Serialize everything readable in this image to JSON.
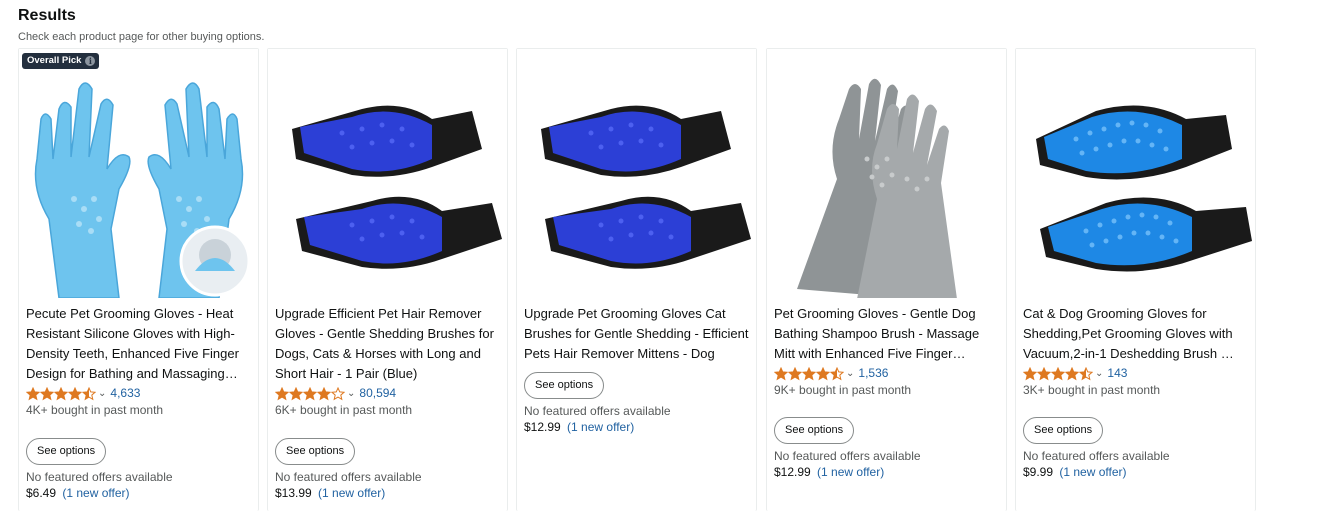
{
  "header": {
    "title": "Results",
    "subtitle": "Check each product page for other buying options."
  },
  "colors": {
    "star_fill": "#de7921",
    "link": "#2162a1",
    "badge_bg": "#232f3e"
  },
  "products": [
    {
      "badge": "Overall Pick",
      "title": "Pecute Pet Grooming Gloves - Heat Resistant Silicone Gloves with High-Density Teeth, Enhanced Five Finger Design for Bathing and Massaging…",
      "rating": 4.5,
      "rating_count": "4,633",
      "bought": "4K+ bought in past month",
      "button": "See options",
      "no_offers": "No featured offers available",
      "price": "$6.49",
      "offer": "(1 new offer)",
      "image_icon": "blue-silicone-gloves"
    },
    {
      "title": "Upgrade Efficient Pet Hair Remover Gloves - Gentle Shedding Brushes for Dogs, Cats & Horses with Long and Short Hair - 1 Pair (Blue)",
      "rating": 4.0,
      "rating_count": "80,594",
      "bought": "6K+ bought in past month",
      "button": "See options",
      "no_offers": "No featured offers available",
      "price": "$13.99",
      "offer": "(1 new offer)",
      "image_icon": "blue-rubber-grooming-gloves"
    },
    {
      "title": "Upgrade Pet Grooming Gloves Cat Brushes for Gentle Shedding - Efficient Pets Hair Remover Mittens - Dog Washing Gloves for Long and…",
      "button": "See options",
      "no_offers": "No featured offers available",
      "price": "$12.99",
      "offer": "(1 new offer)",
      "image_icon": "blue-rubber-grooming-gloves"
    },
    {
      "title": "Pet Grooming Gloves - Gentle Dog Bathing Shampoo Brush - Massage Mitt with Enhanced Five Finger…",
      "rating": 4.5,
      "rating_count": "1,536",
      "bought": "9K+ bought in past month",
      "button": "See options",
      "no_offers": "No featured offers available",
      "price": "$12.99",
      "offer": "(1 new offer)",
      "image_icon": "gray-silicone-gloves"
    },
    {
      "title": "Cat & Dog Grooming Gloves for Shedding,Pet Grooming Gloves with Vacuum,2-in-1 Deshedding Brush …",
      "rating": 4.5,
      "rating_count": "143",
      "bought": "3K+ bought in past month",
      "button": "See options",
      "no_offers": "No featured offers available",
      "price": "$9.99",
      "offer": "(1 new offer)",
      "image_icon": "light-blue-bristle-gloves"
    }
  ]
}
